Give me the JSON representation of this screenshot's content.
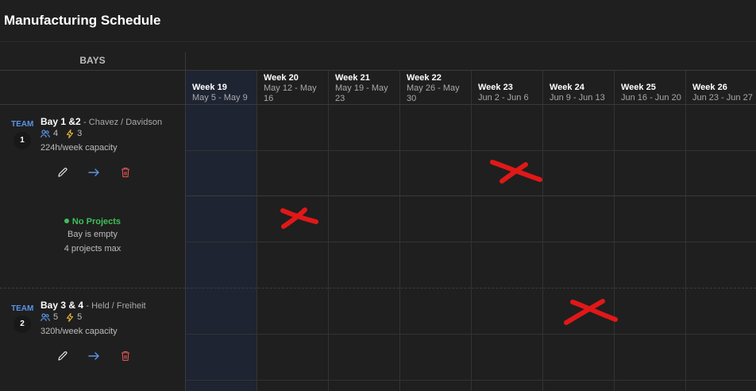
{
  "page": {
    "title": "Manufacturing Schedule"
  },
  "bays_header": "BAYS",
  "weeks": [
    {
      "label": "Week 19",
      "range": "May 5 - May 9"
    },
    {
      "label": "Week 20",
      "range": "May 12 - May 16"
    },
    {
      "label": "Week 21",
      "range": "May 19 - May 23"
    },
    {
      "label": "Week 22",
      "range": "May 26 - May 30"
    },
    {
      "label": "Week 23",
      "range": "Jun 2 - Jun 6"
    },
    {
      "label": "Week 24",
      "range": "Jun 9 - Jun 13"
    },
    {
      "label": "Week 25",
      "range": "Jun 16 - Jun 20"
    },
    {
      "label": "Week 26",
      "range": "Jun 23 - Jun 27"
    }
  ],
  "bays": [
    {
      "team_label": "TEAM",
      "team_number": "1",
      "name": "Bay 1 &2",
      "leads": "- Chavez / Davidson",
      "members": "4",
      "energy": "3",
      "capacity": "224h/week capacity",
      "empty": {
        "status": "No Projects",
        "line1": "Bay is empty",
        "line2": "4 projects max"
      }
    },
    {
      "team_label": "TEAM",
      "team_number": "2",
      "name": "Bay 3 & 4",
      "leads": "- Held / Freiheit",
      "members": "5",
      "energy": "5",
      "capacity": "320h/week capacity"
    }
  ],
  "icons": {
    "edit": "pencil-icon",
    "move": "arrow-right-icon",
    "delete": "trash-icon",
    "members": "people-icon",
    "energy": "bolt-icon",
    "annotation": "red-x-mark"
  },
  "colors": {
    "background": "#1f1f1f",
    "current_week": "#1e2432",
    "accent_blue": "#5a93e8",
    "status_green": "#3fbf5a",
    "bolt_yellow": "#e5b53a",
    "delete_red": "#e05555",
    "annotation_red": "#e01818"
  }
}
